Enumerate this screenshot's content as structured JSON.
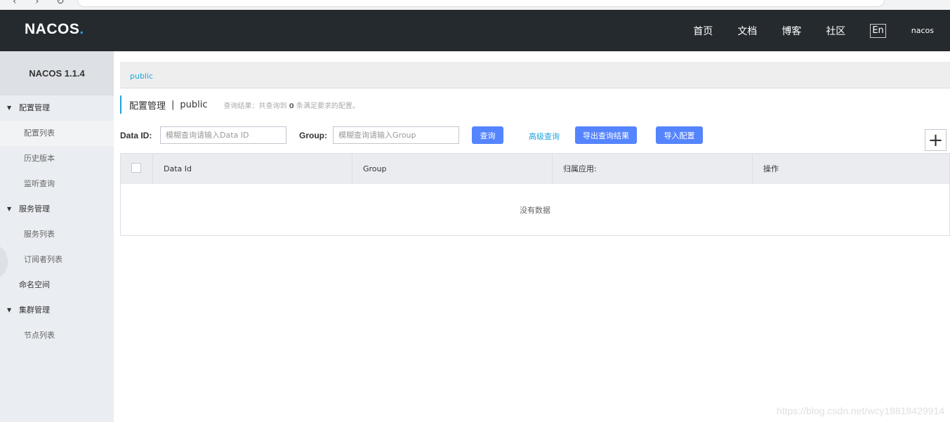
{
  "header": {
    "logo": "NACOS",
    "logo_dot": ".",
    "nav": [
      "首页",
      "文档",
      "博客",
      "社区"
    ],
    "lang": "En",
    "user": "nacos"
  },
  "sidebar": {
    "version": "NACOS 1.1.4",
    "groups": [
      {
        "label": "配置管理",
        "items": [
          "配置列表",
          "历史版本",
          "监听查询"
        ]
      },
      {
        "label": "服务管理",
        "items": [
          "服务列表",
          "订阅者列表"
        ]
      },
      {
        "label": "命名空间"
      },
      {
        "label": "集群管理",
        "items": [
          "节点列表"
        ]
      }
    ],
    "active_item": "配置列表"
  },
  "main": {
    "namespace_tab": "public",
    "title": "配置管理",
    "title_sep": "|",
    "namespace": "public",
    "result_prefix": "查询结果：共查询到",
    "result_count": "0",
    "result_suffix": "条满足要求的配置。",
    "search": {
      "dataid_label": "Data ID:",
      "dataid_placeholder": "模糊查询请输入Data ID",
      "group_label": "Group:",
      "group_placeholder": "模糊查询请输入Group",
      "query_button": "查询",
      "advanced_link": "高级查询",
      "export_button": "导出查询结果",
      "import_button": "导入配置",
      "add_button": "+"
    },
    "table": {
      "columns": [
        "Data Id",
        "Group",
        "归属应用:",
        "操作"
      ],
      "empty_text": "没有数据"
    }
  },
  "watermark": "https://blog.csdn.net/wcy18818429914",
  "colors": {
    "header_bg": "#252a2f",
    "accent": "#1ea4dd",
    "button": "#5584ff",
    "sidebar_bg": "#eaedf1"
  }
}
